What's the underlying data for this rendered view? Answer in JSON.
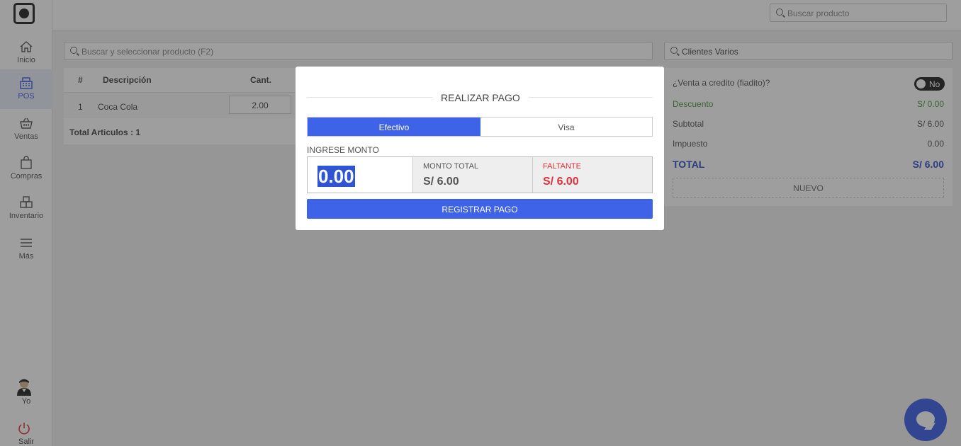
{
  "sidebar": {
    "items": [
      {
        "label": "Inicio",
        "icon": "home-icon"
      },
      {
        "label": "POS",
        "icon": "cash-register-icon"
      },
      {
        "label": "Ventas",
        "icon": "basket-icon"
      },
      {
        "label": "Compras",
        "icon": "shopping-bag-icon"
      },
      {
        "label": "Inventario",
        "icon": "boxes-icon"
      },
      {
        "label": "Más",
        "icon": "menu-icon"
      }
    ],
    "user_label": "Yo",
    "logout_label": "Salir"
  },
  "topbar": {
    "search_placeholder": "Buscar producto"
  },
  "pos": {
    "product_search_placeholder": "Buscar y seleccionar producto (F2)",
    "client": "Clientes Varios",
    "table": {
      "headers": [
        "#",
        "Descripción",
        "Cant."
      ],
      "rows": [
        {
          "num": "1",
          "description": "Coca Cola",
          "qty": "2.00"
        }
      ]
    },
    "total_articles": "Total Articulos : 1"
  },
  "summary": {
    "credit_label": "¿Venta a credito (fiadito)?",
    "credit_toggle": "No",
    "discount_label": "Descuento",
    "discount_value": "S/ 0.00",
    "subtotal_label": "Subtotal",
    "subtotal_value": "S/ 6.00",
    "tax_label": "Impuesto",
    "tax_value": "0.00",
    "total_label": "TOTAL",
    "total_value": "S/ 6.00",
    "new_label": "NUEVO"
  },
  "modal": {
    "title": "REALIZAR PAGO",
    "tabs": [
      "Efectivo",
      "Visa"
    ],
    "enter_amount_label": "INGRESE MONTO",
    "amount": "0.00",
    "total_label": "MONTO TOTAL",
    "total_value": "S/ 6.00",
    "missing_label": "FALTANTE",
    "missing_value": "S/ 6.00",
    "register_button": "REGISTRAR PAGO"
  },
  "colors": {
    "accent": "#3f63e8",
    "discount_green": "#4a9a3c",
    "total_blue": "#2f4fc8",
    "missing_red": "#e0303b"
  }
}
